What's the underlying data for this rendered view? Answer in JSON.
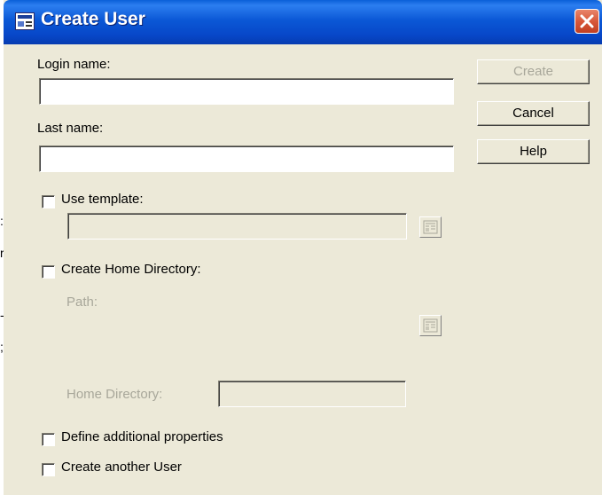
{
  "window": {
    "title": "Create User",
    "icon": "dialog-window-icon",
    "close_icon": "close-icon"
  },
  "form": {
    "login_name_label": "Login name:",
    "login_name_value": "",
    "last_name_label": "Last name:",
    "last_name_value": "",
    "use_template_label": "Use template:",
    "use_template_checked": false,
    "template_value": "",
    "create_home_dir_label": "Create Home Directory:",
    "create_home_dir_checked": false,
    "path_label": "Path:",
    "home_directory_label": "Home Directory:",
    "home_directory_value": "",
    "define_props_label": "Define additional properties",
    "define_props_checked": false,
    "create_another_label": "Create another User",
    "create_another_checked": false,
    "browse_icon": "browse-icon"
  },
  "buttons": {
    "create": "Create",
    "cancel": "Cancel",
    "help": "Help"
  },
  "colors": {
    "titlebar": "#0b58d6",
    "dialog_bg": "#ece9d8",
    "close_button": "#d8583a",
    "disabled_text": "#a8a79a"
  }
}
